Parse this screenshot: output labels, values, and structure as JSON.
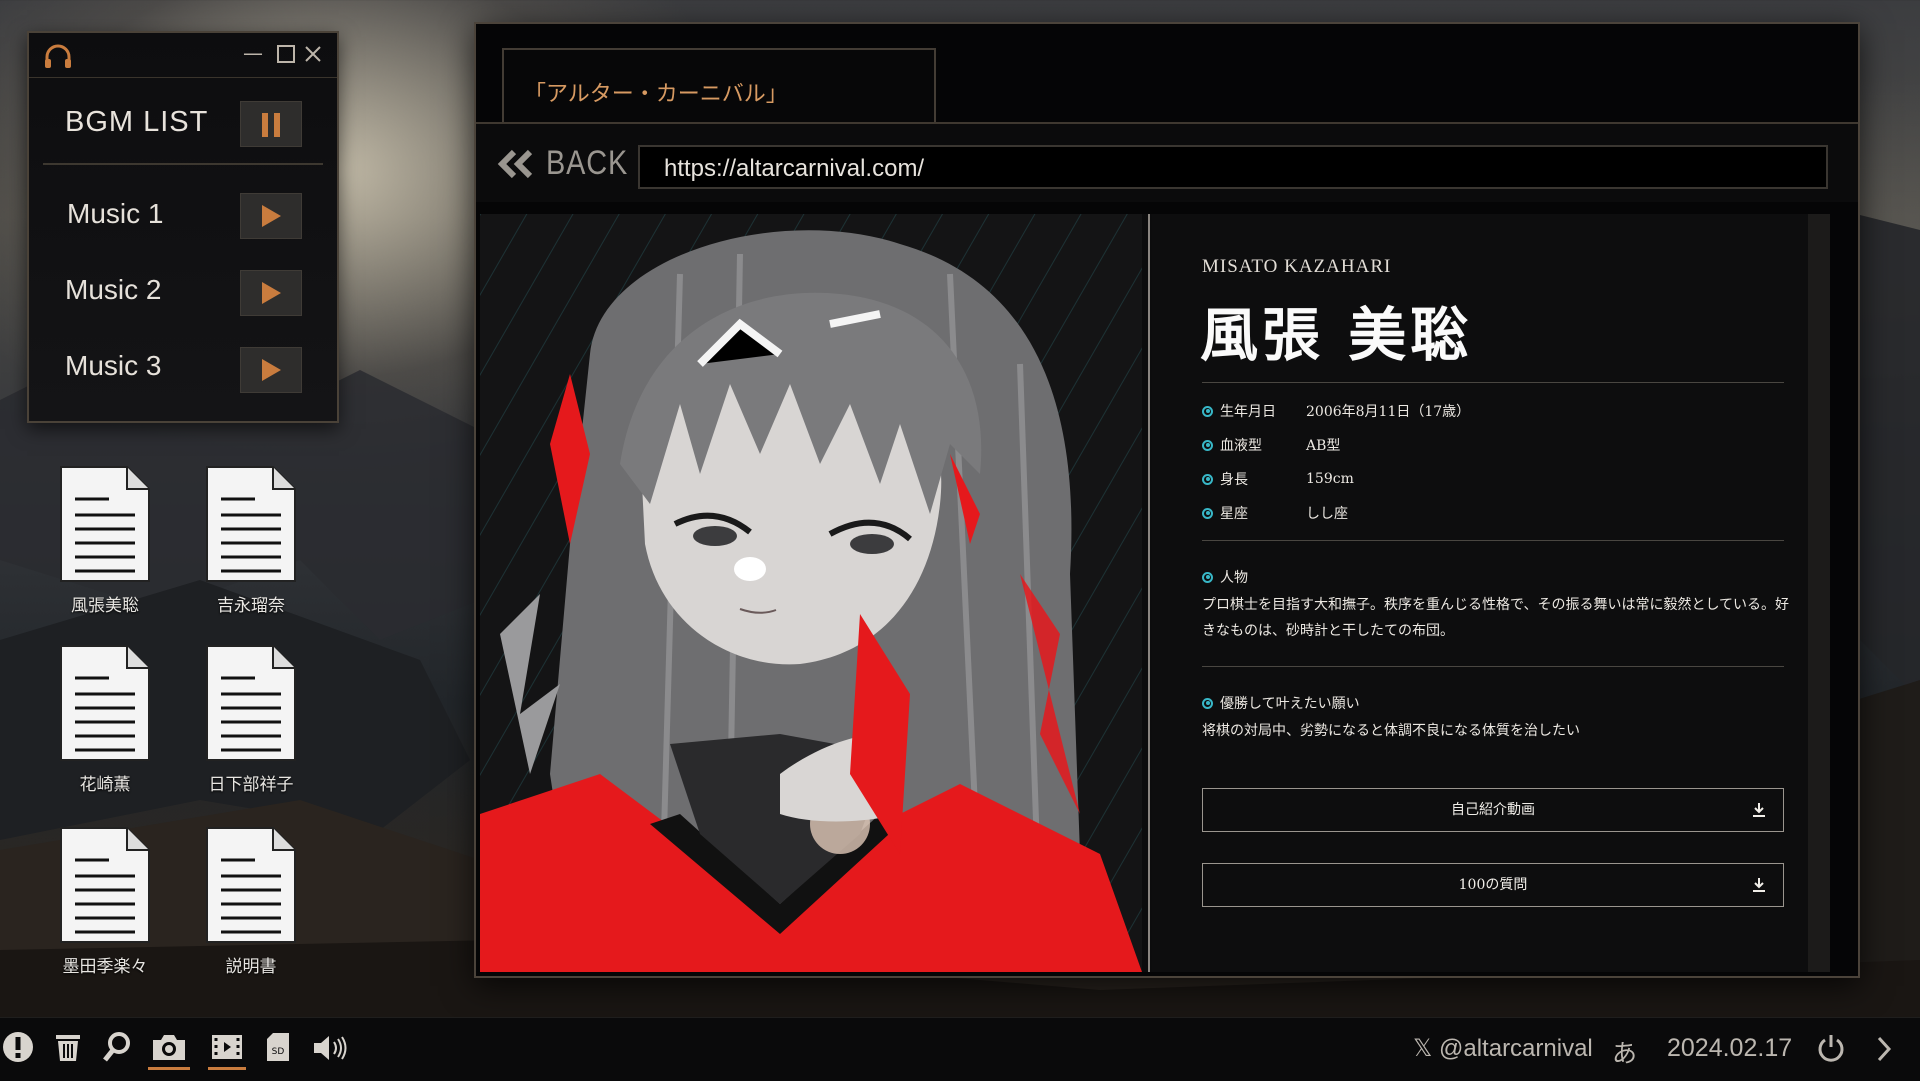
{
  "bgm": {
    "title": "BGM LIST",
    "tracks": [
      {
        "label": "Music 1"
      },
      {
        "label": "Music 2"
      },
      {
        "label": "Music 3"
      }
    ]
  },
  "desktop_icons": [
    {
      "label": "風張美聡"
    },
    {
      "label": "吉永瑠奈"
    },
    {
      "label": "花崎薫"
    },
    {
      "label": "日下部祥子"
    },
    {
      "label": "墨田季楽々"
    },
    {
      "label": "説明書"
    }
  ],
  "browser": {
    "tab_title": "「アルター・カーニバル」",
    "back_label": "BACK",
    "url": "https://altarcarnival.com/"
  },
  "profile": {
    "romaji": "MISATO KAZAHARI",
    "name": "風張 美聡",
    "fields": [
      {
        "label": "生年月日",
        "value": "2006年8月11日（17歳）"
      },
      {
        "label": "血液型",
        "value": "AB型"
      },
      {
        "label": "身長",
        "value": "159cm"
      },
      {
        "label": "星座",
        "value": "しし座"
      }
    ],
    "personality_label": "人物",
    "personality_text": "プロ棋士を目指す大和撫子。秩序を重んじる性格で、その振る舞いは常に毅然としている。好きなものは、砂時計と干したての布団。",
    "wish_label": "優勝して叶えたい願い",
    "wish_text": "将棋の対局中、劣勢になると体調不良になる体質を治したい",
    "buttons": [
      {
        "label": "自己紹介動画"
      },
      {
        "label": "100の質問"
      }
    ]
  },
  "taskbar": {
    "social": "𝕏 @altarcarnival",
    "ime": "あ",
    "date": "2024.02.17"
  },
  "colors": {
    "accent_orange": "#c97c3e",
    "bullet_teal": "#38b7c7",
    "kimono_red": "#e5191c"
  }
}
